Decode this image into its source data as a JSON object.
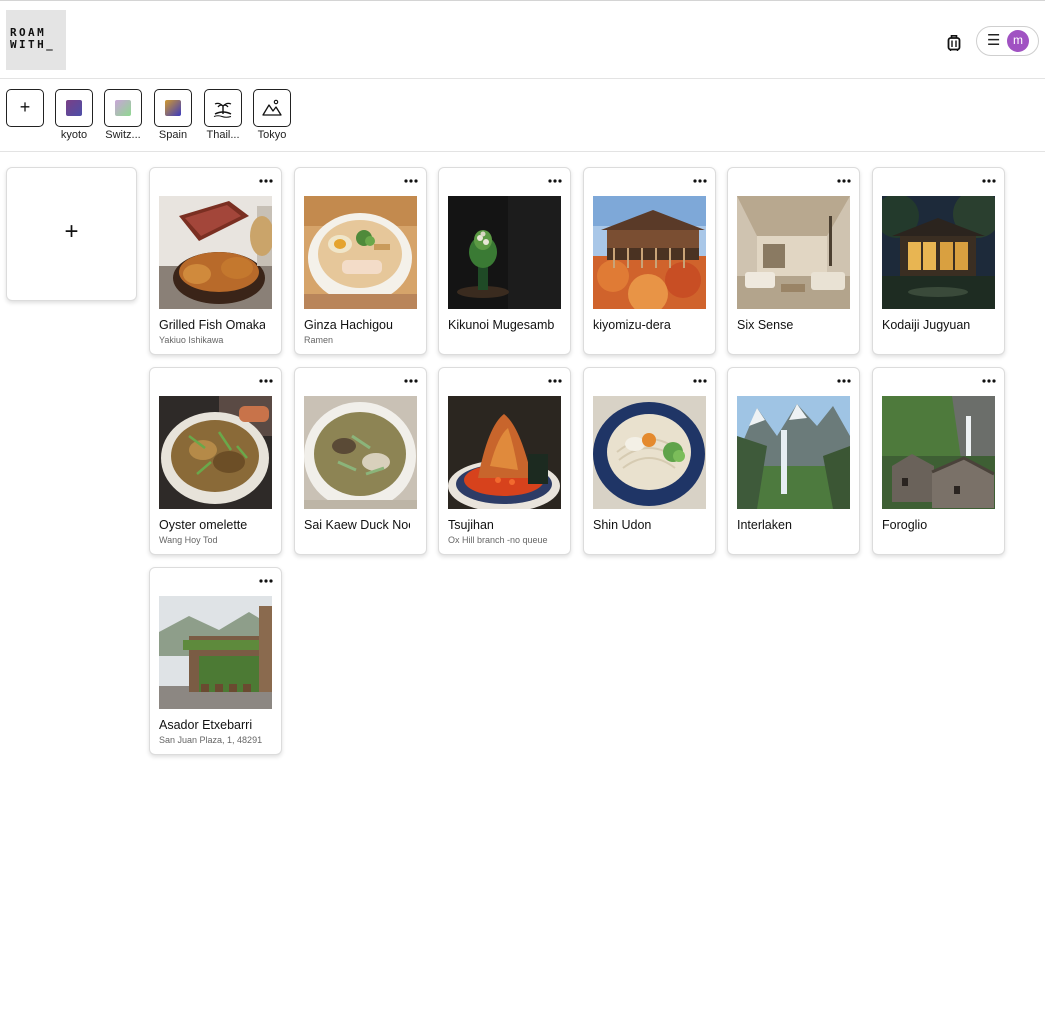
{
  "app": {
    "logo_line1": "ROAM",
    "logo_line2": "WITH_",
    "user_initial": "m",
    "menu_glyph": "☰"
  },
  "trips": {
    "add_label": "+",
    "items": [
      {
        "label": "kyoto",
        "icon": "gradient-swatch",
        "colors": [
          "#7a3f86",
          "#4c4fa8"
        ]
      },
      {
        "label": "Switz...",
        "icon": "gradient-swatch",
        "colors": [
          "#c9a5d8",
          "#8fd890"
        ]
      },
      {
        "label": "Spain",
        "icon": "gradient-swatch",
        "colors": [
          "#d19a2e",
          "#3b3ac0"
        ]
      },
      {
        "label": "Thail...",
        "icon": "island-icon",
        "colors": []
      },
      {
        "label": "Tokyo",
        "icon": "mountain-icon",
        "colors": []
      }
    ]
  },
  "places": {
    "add_label": "+",
    "items": [
      {
        "title": "Grilled Fish Omakase",
        "subtitle": "Yakiuo Ishikawa"
      },
      {
        "title": "Ginza Hachigou",
        "subtitle": "Ramen"
      },
      {
        "title": "Kikunoi Mugesambo",
        "subtitle": ""
      },
      {
        "title": "kiyomizu-dera",
        "subtitle": ""
      },
      {
        "title": "Six Sense",
        "subtitle": ""
      },
      {
        "title": "Kodaiji Jugyuan",
        "subtitle": ""
      },
      {
        "title": "Oyster omelette",
        "subtitle": "Wang Hoy Tod"
      },
      {
        "title": "Sai Kaew Duck Noodle",
        "subtitle": ""
      },
      {
        "title": "Tsujihan",
        "subtitle": "Ox Hill branch -no queue"
      },
      {
        "title": "Shin Udon",
        "subtitle": ""
      },
      {
        "title": "Interlaken",
        "subtitle": ""
      },
      {
        "title": "Foroglio",
        "subtitle": ""
      },
      {
        "title": "Asador Etxebarri",
        "subtitle": "San Juan Plaza, 1, 48291"
      }
    ]
  }
}
